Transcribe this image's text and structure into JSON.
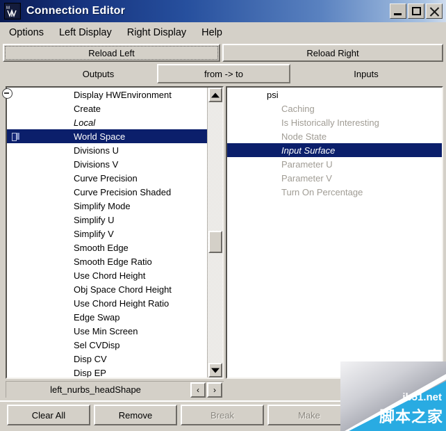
{
  "window": {
    "title": "Connection Editor",
    "icon": "maya-logo-icon",
    "controls": {
      "minimize": "minimize-icon",
      "maximize": "maximize-icon",
      "close": "close-icon"
    }
  },
  "menubar": {
    "items": [
      {
        "label": "Options"
      },
      {
        "label": "Left Display"
      },
      {
        "label": "Right Display"
      },
      {
        "label": "Help"
      }
    ]
  },
  "toolbar": {
    "reload_left": "Reload Left",
    "reload_right": "Reload Right"
  },
  "tabs": {
    "outputs": "Outputs",
    "from_to": "from -> to",
    "inputs": "Inputs"
  },
  "left_panel": {
    "selected_index": 3,
    "items": [
      {
        "label": "Display HWEnvironment",
        "style": "normal"
      },
      {
        "label": "Create",
        "style": "normal"
      },
      {
        "label": "Local",
        "style": "italic"
      },
      {
        "label": "World Space",
        "style": "selected"
      },
      {
        "label": "Divisions U",
        "style": "normal"
      },
      {
        "label": "Divisions V",
        "style": "normal"
      },
      {
        "label": "Curve Precision",
        "style": "normal"
      },
      {
        "label": "Curve Precision Shaded",
        "style": "normal"
      },
      {
        "label": "Simplify Mode",
        "style": "normal"
      },
      {
        "label": "Simplify U",
        "style": "normal"
      },
      {
        "label": "Simplify V",
        "style": "normal"
      },
      {
        "label": "Smooth Edge",
        "style": "normal"
      },
      {
        "label": "Smooth Edge Ratio",
        "style": "normal"
      },
      {
        "label": "Use Chord Height",
        "style": "normal"
      },
      {
        "label": "Obj Space Chord Height",
        "style": "normal"
      },
      {
        "label": "Use Chord Height Ratio",
        "style": "normal"
      },
      {
        "label": "Edge Swap",
        "style": "normal"
      },
      {
        "label": "Use Min Screen",
        "style": "normal"
      },
      {
        "label": "Sel CVDisp",
        "style": "normal"
      },
      {
        "label": "Disp CV",
        "style": "normal"
      },
      {
        "label": "Disp EP",
        "style": "normal"
      }
    ],
    "scrollbar": {
      "up": "scroll-up-icon",
      "down": "scroll-down-icon"
    }
  },
  "right_panel": {
    "root": {
      "label": "psi",
      "toggle": "collapse-icon"
    },
    "selected_index": 3,
    "items": [
      {
        "label": "Caching",
        "style": "disabled"
      },
      {
        "label": "Is Historically Interesting",
        "style": "disabled"
      },
      {
        "label": "Node State",
        "style": "disabled"
      },
      {
        "label": "Input Surface",
        "style": "selected"
      },
      {
        "label": "Parameter U",
        "style": "disabled"
      },
      {
        "label": "Parameter V",
        "style": "disabled"
      },
      {
        "label": "Turn On Percentage",
        "style": "disabled"
      }
    ]
  },
  "field": {
    "value": "left_nurbs_headShape",
    "prev": "‹",
    "next": "›"
  },
  "bottom_buttons": {
    "clear_all": "Clear All",
    "remove": "Remove",
    "break": "Break",
    "make": "Make"
  },
  "watermark": {
    "site": "jb51.net",
    "cn": "脚本之家"
  },
  "colors": {
    "titlebar_dark": "#0a1a52",
    "titlebar_light": "#cfdcee",
    "face": "#d4d0c8",
    "selection": "#0b1f6b",
    "disabled_text": "#a09c94",
    "watermark_blue": "#29abe2"
  }
}
